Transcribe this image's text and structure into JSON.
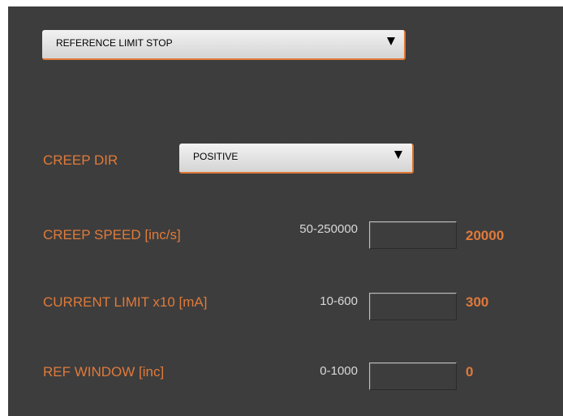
{
  "mode_select": {
    "value": "REFERENCE LIMIT STOP"
  },
  "creep_dir": {
    "label": "CREEP DIR",
    "value": "POSITIVE"
  },
  "params": [
    {
      "label": "CREEP SPEED [inc/s]",
      "range": "50-250000",
      "input_value": "",
      "current": "20000"
    },
    {
      "label": "CURRENT LIMIT x10 [mA]",
      "range": "10-600",
      "input_value": "",
      "current": "300"
    },
    {
      "label": "REF WINDOW [inc]",
      "range": "0-1000",
      "input_value": "",
      "current": "0"
    }
  ],
  "colors": {
    "accent": "#e07a3a",
    "background": "#3d3d3d",
    "range_text": "#d8d8d8"
  },
  "icons": {
    "dropdown_arrow": "chevron-down-icon"
  }
}
